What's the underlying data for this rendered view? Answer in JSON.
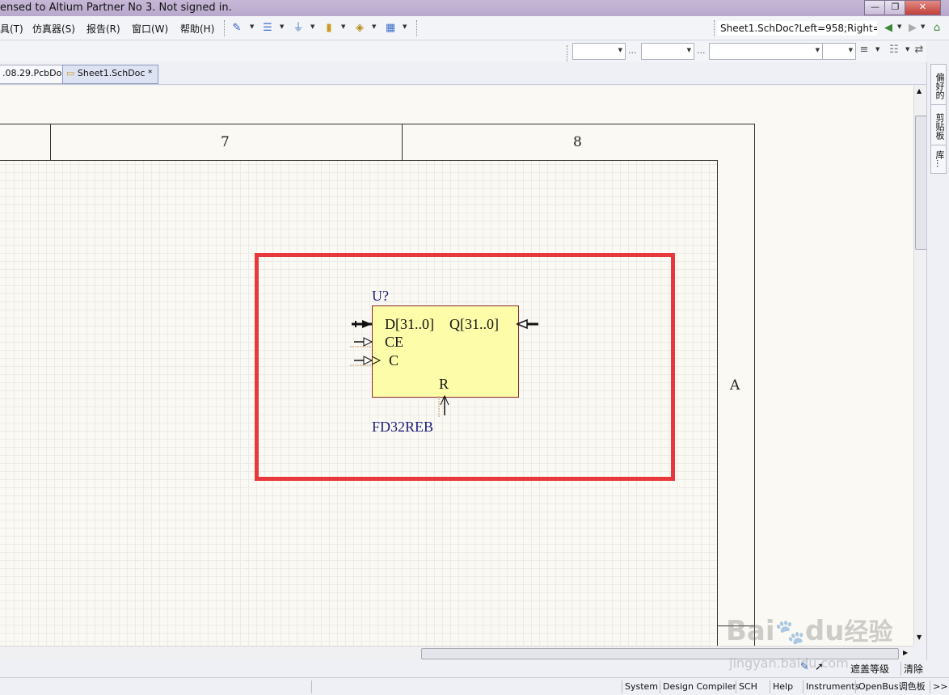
{
  "window": {
    "title": "ensed to Altium Partner No 3. Not signed in.",
    "min_label": "—",
    "max_label": "❐",
    "close_label": "✕"
  },
  "menu": {
    "items": [
      "具(T)",
      "仿真器(S)",
      "报告(R)",
      "窗口(W)",
      "帮助(H)"
    ]
  },
  "address": {
    "value": "Sheet1.SchDoc?Left=958;Right="
  },
  "toolbar2": {
    "dots": "..."
  },
  "tabs": [
    {
      "label": ".08.29.PcbDoc"
    },
    {
      "label": "Sheet1.SchDoc *"
    }
  ],
  "schematic": {
    "zone_cols": [
      "7",
      "8"
    ],
    "zone_row": "A",
    "component": {
      "designator": "U?",
      "name": "FD32REB",
      "pins": {
        "d": "D[31..0]",
        "q": "Q[31..0]",
        "ce": "CE",
        "c": "C",
        "r": "R"
      }
    }
  },
  "side_panels": [
    "偏好的",
    "剪贴板",
    "库..."
  ],
  "bottom_strip": {
    "mask_label": "遮盖等级",
    "clear_label": "清除"
  },
  "status_bar": {
    "buttons": [
      "System",
      "Design Compiler",
      "SCH",
      "Help",
      "Instruments",
      "OpenBus调色板",
      ">>"
    ]
  },
  "watermark": {
    "logo": "Bai",
    "logo2": "du",
    "suffix": "经验",
    "url": "jingyan.baidu.com"
  },
  "colors": {
    "highlight": "#e8383b",
    "component_fill": "#fdfca8",
    "designator": "#1c1c7a"
  }
}
